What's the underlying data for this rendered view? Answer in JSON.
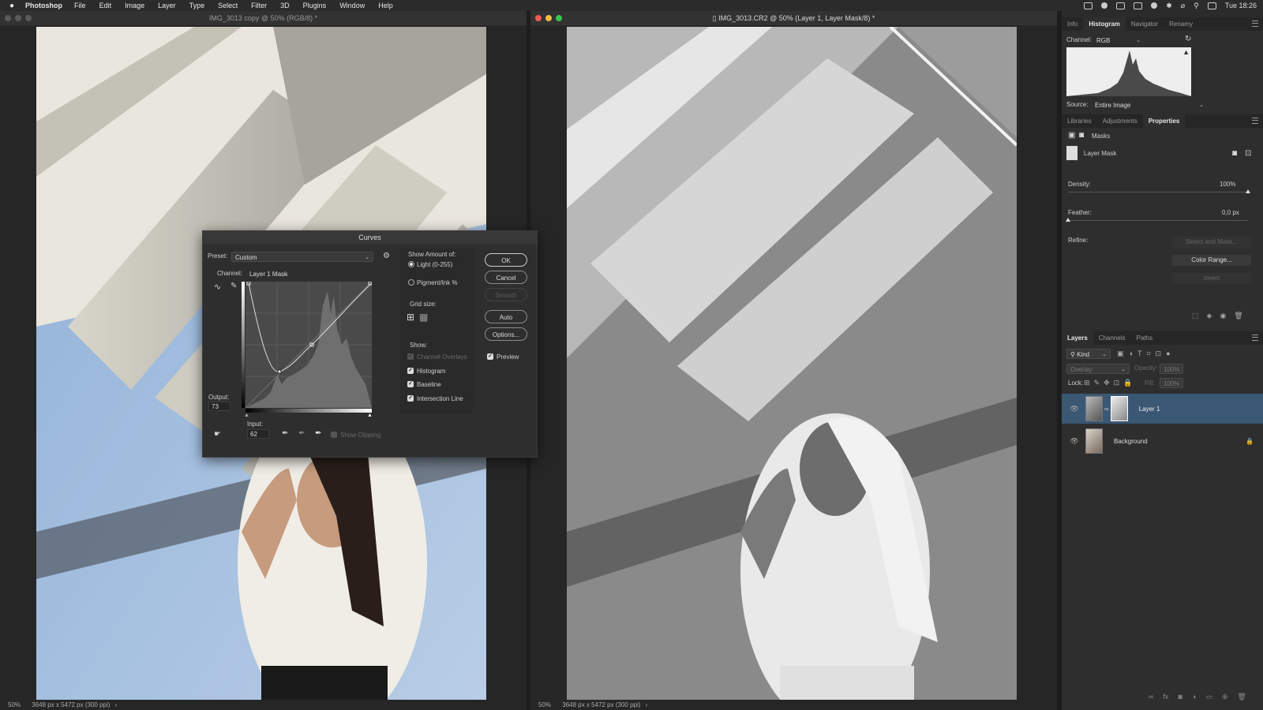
{
  "menubar": {
    "app": "Photoshop",
    "items": [
      "File",
      "Edit",
      "Image",
      "Layer",
      "Type",
      "Select",
      "Filter",
      "3D",
      "Plugins",
      "Window",
      "Help"
    ],
    "clock": "Tue 18:26"
  },
  "left_doc": {
    "title": "IMG_3013 copy @ 50% (RGB/8) *",
    "zoom": "50%",
    "info": "3648 px x 5472 px (300 ppi)"
  },
  "right_doc": {
    "title": "IMG_3013.CR2 @ 50% (Layer 1, Layer Mask/8) *",
    "zoom": "50%",
    "info": "3648 px x 5472 px (300 ppi)"
  },
  "curves": {
    "title": "Curves",
    "preset_label": "Preset:",
    "preset_value": "Custom",
    "channel_label": "Channel:",
    "channel_value": "Layer 1 Mask",
    "output_label": "Output:",
    "output_value": "73",
    "input_label": "Input:",
    "input_value": "62",
    "show_clipping": "Show Clipping",
    "show_amount_label": "Show Amount of:",
    "light_label": "Light  (0-255)",
    "pigment_label": "Pigment/Ink %",
    "grid_size_label": "Grid size:",
    "show_label": "Show:",
    "channel_overlays": "Channel Overlays",
    "histogram": "Histogram",
    "baseline": "Baseline",
    "intersection_line": "Intersection Line",
    "ok": "OK",
    "cancel": "Cancel",
    "smooth": "Smooth",
    "auto": "Auto",
    "options": "Options...",
    "preview": "Preview"
  },
  "info_panel": {
    "tabs": [
      "Info",
      "Histogram",
      "Navigator",
      "Renamy"
    ],
    "active_tab": "Histogram",
    "channel_label": "Channel:",
    "channel_value": "RGB",
    "source_label": "Source:",
    "source_value": "Entire Image"
  },
  "properties_panel": {
    "tabs": [
      "Libraries",
      "Adjustments",
      "Properties"
    ],
    "active_tab": "Properties",
    "masks_label": "Masks",
    "layer_mask_label": "Layer Mask",
    "density_label": "Density:",
    "density_value": "100%",
    "density_level": 1.0,
    "feather_label": "Feather:",
    "feather_value": "0,0 px",
    "feather_level": 0.0,
    "refine_label": "Refine:",
    "select_and_mask": "Select and Mask...",
    "color_range": "Color Range...",
    "invert": "Invert"
  },
  "layers_panel": {
    "tabs": [
      "Layers",
      "Channels",
      "Paths"
    ],
    "active_tab": "Layers",
    "kind_label": "Kind",
    "blend_mode": "Overlay",
    "opacity_label": "Opacity:",
    "opacity_value": "100%",
    "lock_label": "Lock:",
    "fill_label": "Fill:",
    "fill_value": "100%",
    "layers": [
      {
        "name": "Layer 1",
        "selected": true
      },
      {
        "name": "Background",
        "selected": false
      }
    ]
  },
  "colors": {
    "accent": "#3c5a7a",
    "ok_blue": "#2d6fd2"
  }
}
